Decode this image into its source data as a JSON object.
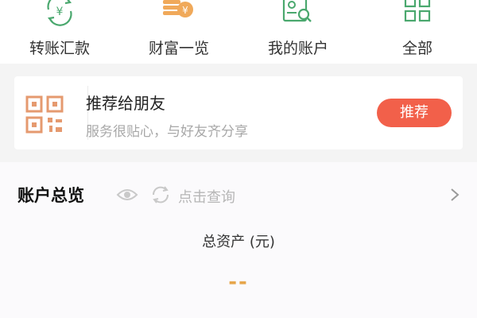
{
  "nav": {
    "items": [
      {
        "label": "转账汇款",
        "icon": "yuan-transfer-icon"
      },
      {
        "label": "财富一览",
        "icon": "coin-stack-icon"
      },
      {
        "label": "我的账户",
        "icon": "account-search-icon"
      },
      {
        "label": "全部",
        "icon": "grid-icon"
      }
    ]
  },
  "recommend": {
    "title": "推荐给朋友",
    "subtitle": "服务很贴心，与好友齐分享",
    "button_label": "推荐",
    "icon": "qr-code-icon"
  },
  "account": {
    "title": "账户总览",
    "query_label": "点击查询",
    "total_label": "总资产 (元)",
    "total_value": "--"
  },
  "colors": {
    "green": "#4aa86e",
    "accent_red": "#f2604a",
    "qr_orange": "#e59a6f",
    "value_gold": "#e7a64b"
  }
}
